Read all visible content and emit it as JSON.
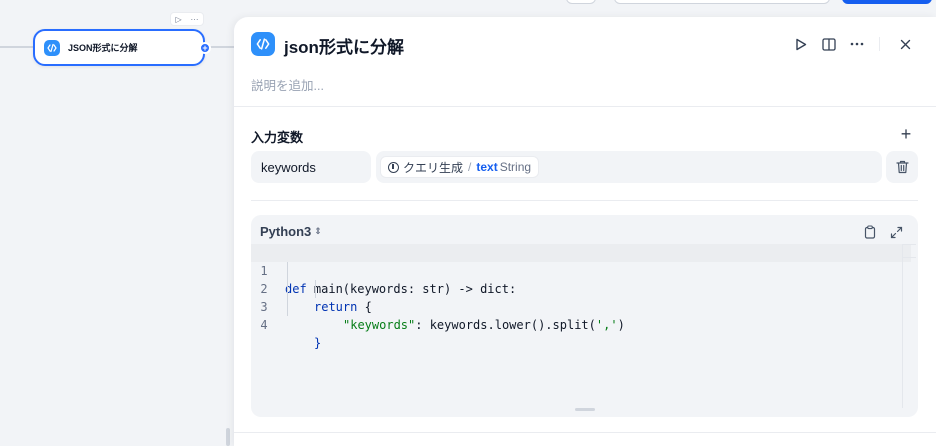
{
  "node": {
    "title": "JSON形式に分解",
    "icon": "code-icon",
    "accent_color": "#296dff",
    "actions": [
      "play-icon",
      "more-icon"
    ]
  },
  "panel": {
    "title": "json形式に分解",
    "description_placeholder": "説明を追加...",
    "header_actions": [
      "play-icon",
      "split-view-icon",
      "more-icon",
      "close-icon"
    ]
  },
  "input_vars": {
    "section_label": "入力変数",
    "items": [
      {
        "name": "keywords",
        "source_node": "クエリ生成",
        "separator": "/",
        "var_name": "text",
        "var_type": "String"
      }
    ]
  },
  "code": {
    "language": "Python3",
    "lines": [
      {
        "num": "1"
      },
      {
        "num": "2"
      },
      {
        "num": "3"
      },
      {
        "num": "4"
      }
    ],
    "tokens": {
      "l1_kw": "def",
      "l1_rest": " main(keywords: str) -> dict:",
      "l2_kw": "return",
      "l2_rest": " {",
      "l3_str": "\"keywords\"",
      "l3_mid": ": keywords.lower().split(",
      "l3_str2": "','",
      "l3_end": ")",
      "l4": "}"
    }
  },
  "colors": {
    "primary": "#155eef",
    "icon_bg": "#2e90fa",
    "keyword": "#0033b3",
    "string": "#067d17"
  }
}
